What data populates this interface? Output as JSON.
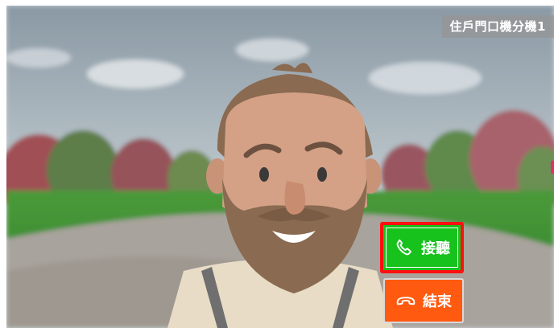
{
  "station": {
    "label": "住戶門口機分機1"
  },
  "controls": {
    "answer_label": "接聽",
    "end_label": "結束",
    "answer_icon": "phone-answer-icon",
    "end_icon": "phone-hangup-icon",
    "answer_color": "#17c21d",
    "end_color": "#ff5a10",
    "highlight_color": "#ff1010"
  },
  "video": {
    "subject": "bearded-man-avatar"
  }
}
